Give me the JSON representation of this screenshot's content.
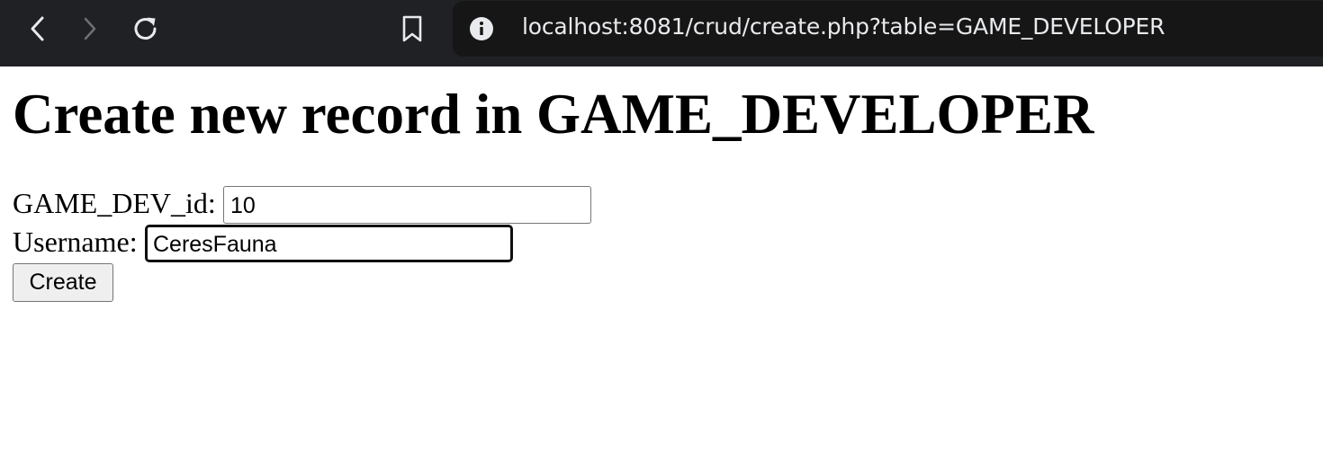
{
  "browser": {
    "url": "localhost:8081/crud/create.php?table=GAME_DEVELOPER",
    "icons": {
      "back": "chevron-left-icon",
      "forward": "chevron-right-icon",
      "reload": "reload-icon",
      "bookmark": "bookmark-icon",
      "site_info": "info-icon"
    }
  },
  "page": {
    "title": "Create new record in GAME_DEVELOPER",
    "form": {
      "fields": [
        {
          "label": "GAME_DEV_id:",
          "value": "10"
        },
        {
          "label": "Username:",
          "value": "CeresFauna"
        }
      ],
      "submit_label": "Create"
    }
  }
}
